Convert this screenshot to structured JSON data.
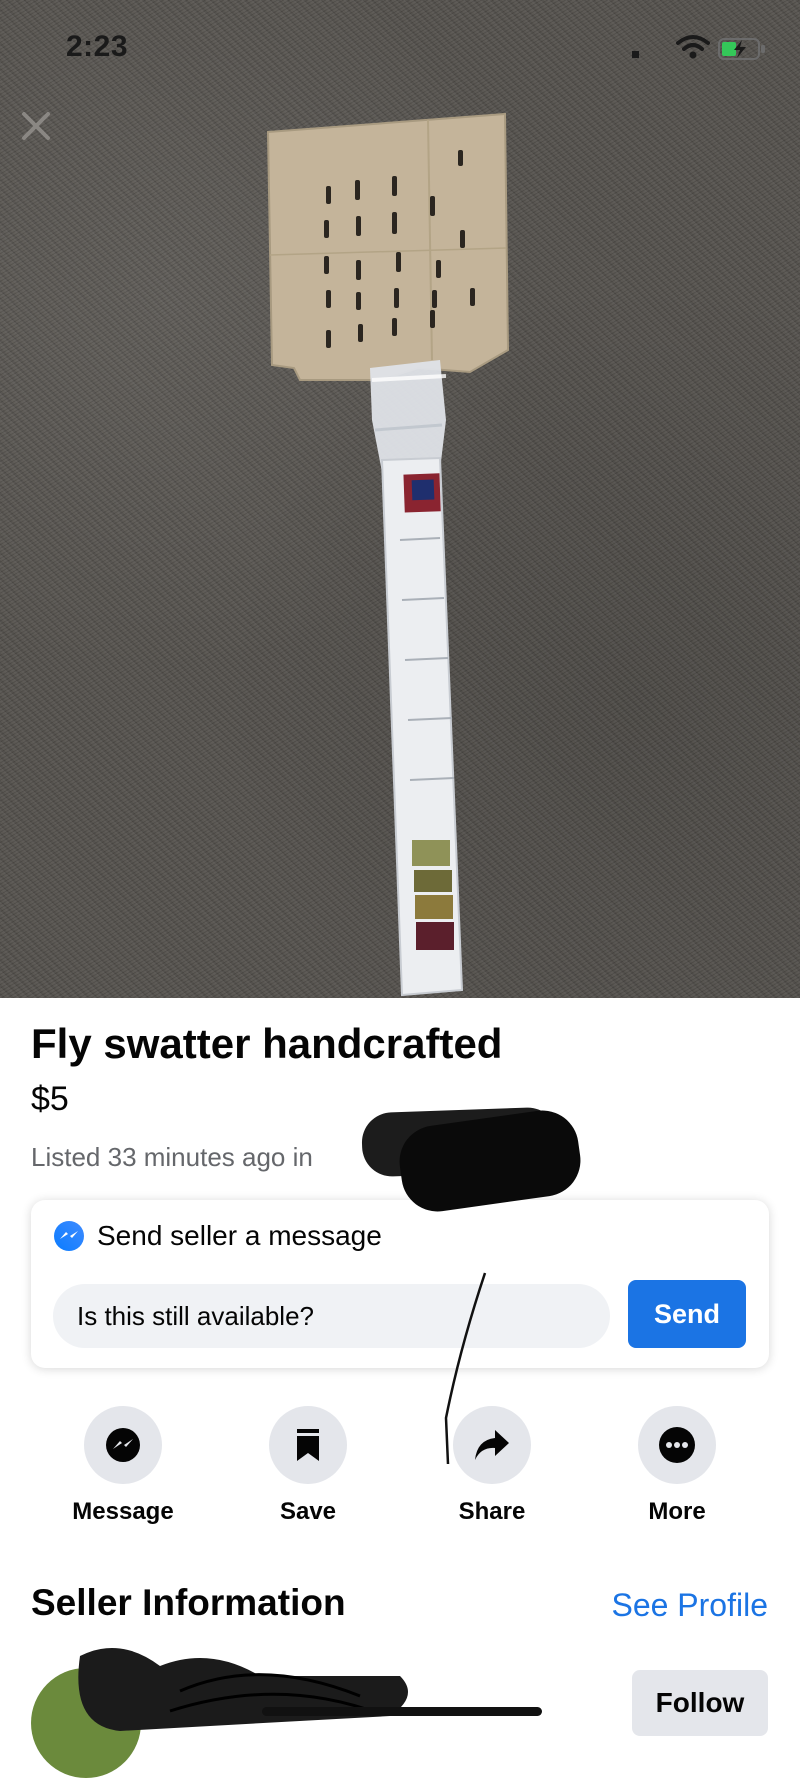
{
  "status_bar": {
    "time": "2:23",
    "icons": [
      "signal-icon",
      "wifi-icon",
      "battery-charging-icon"
    ]
  },
  "photo": {
    "close_icon": "close-icon",
    "subject": "fly-swatter-photo"
  },
  "listing": {
    "title": "Fly swatter handcrafted",
    "price": "$5",
    "listed_text": "Listed 33 minutes ago in"
  },
  "message_card": {
    "icon": "messenger-icon",
    "header": "Send seller a message",
    "input_value": "Is this still available?",
    "send_label": "Send"
  },
  "actions": [
    {
      "label": "Message",
      "icon": "messenger-icon"
    },
    {
      "label": "Save",
      "icon": "bookmark-icon"
    },
    {
      "label": "Share",
      "icon": "share-arrow-icon"
    },
    {
      "label": "More",
      "icon": "more-dots-icon"
    }
  ],
  "seller": {
    "title": "Seller Information",
    "see_profile": "See Profile",
    "follow_label": "Follow"
  },
  "colors": {
    "accent": "#1b74e4",
    "text": "#050505",
    "secondary_text": "#65676b",
    "button_gray": "#e4e6eb"
  }
}
